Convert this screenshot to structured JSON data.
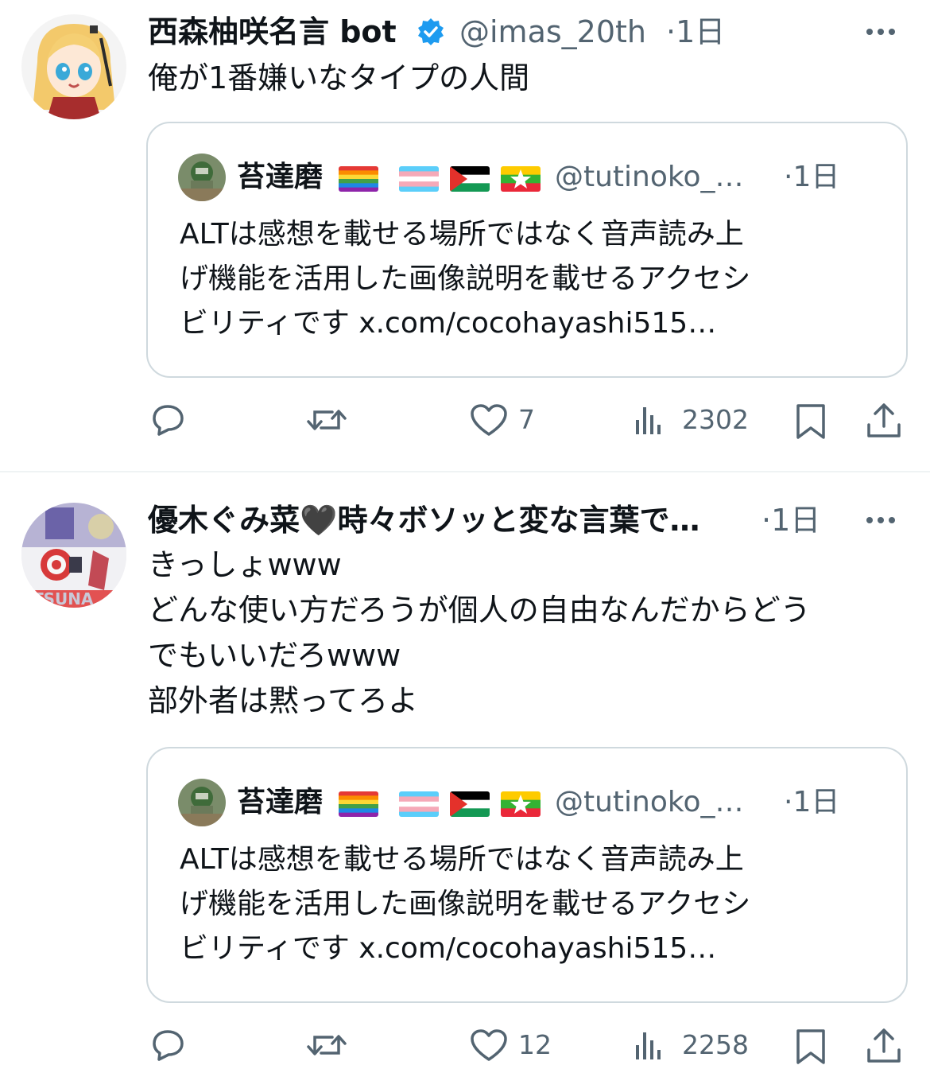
{
  "tweets": [
    {
      "author_name": "西森柚咲名言 bot",
      "handle": "@imas_20th",
      "time": "·1日",
      "text": "俺が1番嫌いなタイプの人間",
      "quote": {
        "author_name": "苔達磨",
        "flags": [
          "rainbow-flag-icon",
          "transgender-flag-icon",
          "palestine-flag-icon",
          "myanmar-flag-icon"
        ],
        "handle": "@tutinoko_…",
        "time": "·1日",
        "text": "ALTは感想を載せる場所ではなく音声読み上\nげ機能を活用した画像説明を載せるアクセシ\nビリティです x.com/cocohayashi515…"
      },
      "actions": {
        "reply": "",
        "repost": "",
        "like": "7",
        "views": "2302"
      }
    },
    {
      "author_name": "優木ぐみ菜🖤時々ボソッと変な言葉で…",
      "handle": "",
      "time": "·1日",
      "text": "きっしょwww\nどんな使い方だろうが個人の自由なんだからどう\nでもいいだろwww\n部外者は黙ってろよ",
      "quote": {
        "author_name": "苔達磨",
        "flags": [
          "rainbow-flag-icon",
          "transgender-flag-icon",
          "palestine-flag-icon",
          "myanmar-flag-icon"
        ],
        "handle": "@tutinoko_…",
        "time": "·1日",
        "text": "ALTは感想を載せる場所ではなく音声読み上\nげ機能を活用した画像説明を載せるアクセシ\nビリティです x.com/cocohayashi515…"
      },
      "actions": {
        "reply": "",
        "repost": "",
        "like": "12",
        "views": "2258"
      }
    }
  ],
  "colors": {
    "text": "#0f1419",
    "secondary": "#536471",
    "verified": "#1d9bf0",
    "border": "#cfd9de"
  }
}
